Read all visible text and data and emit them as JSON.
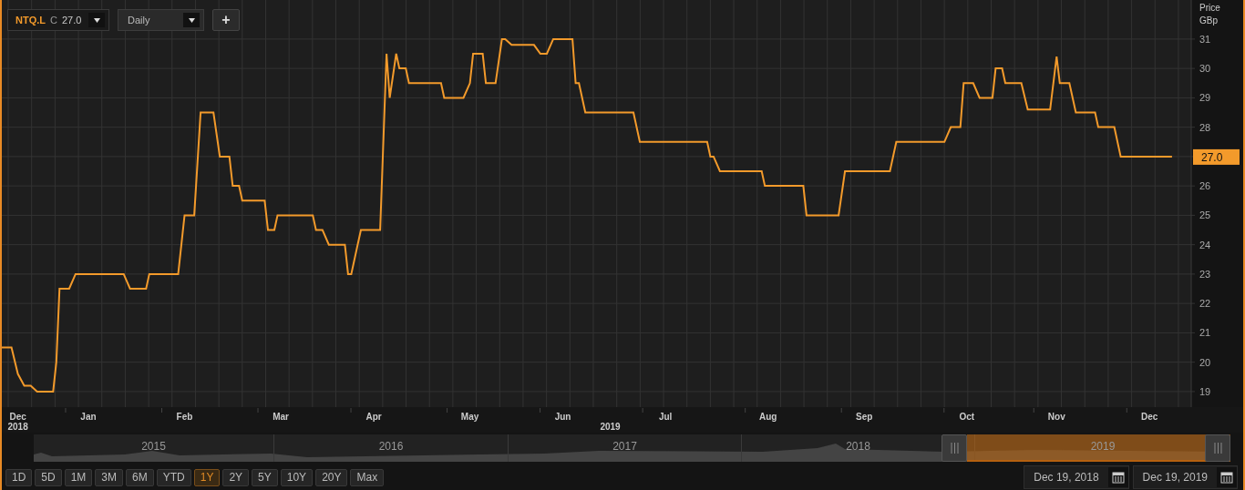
{
  "toolbar": {
    "close_label": "C",
    "close_value": "27.0",
    "interval": "Daily",
    "add_label": "+"
  },
  "chart": {
    "last_value": "27.0",
    "axis_years": [
      "2018",
      "2019"
    ],
    "ylabel_unit": "GBp",
    "chart_data": {
      "type": "line",
      "grid": true,
      "ylabel": "Price",
      "xlim": [
        "2018-12-19",
        "2019-12-25"
      ],
      "ylim": [
        18.47,
        32.33
      ],
      "yticks": [
        19,
        20,
        21,
        22,
        23,
        24,
        25,
        26,
        28,
        29,
        30,
        31
      ],
      "xticks": [
        {
          "value": "2018-12-24",
          "label": "Dec"
        },
        {
          "value": "2019-01-15",
          "label": "Jan"
        },
        {
          "value": "2019-02-14",
          "label": "Feb"
        },
        {
          "value": "2019-03-16",
          "label": "Mar"
        },
        {
          "value": "2019-04-14",
          "label": "Apr"
        },
        {
          "value": "2019-05-14",
          "label": "May"
        },
        {
          "value": "2019-06-12",
          "label": "Jun"
        },
        {
          "value": "2019-07-14",
          "label": "Jul"
        },
        {
          "value": "2019-08-15",
          "label": "Aug"
        },
        {
          "value": "2019-09-14",
          "label": "Sep"
        },
        {
          "value": "2019-10-16",
          "label": "Oct"
        },
        {
          "value": "2019-11-13",
          "label": "Nov"
        },
        {
          "value": "2019-12-12",
          "label": "Dec"
        }
      ],
      "x": [
        "2018-12-19",
        "2018-12-22",
        "2018-12-24",
        "2018-12-26",
        "2018-12-28",
        "2018-12-30",
        "2019-01-04",
        "2019-01-05",
        "2019-01-06",
        "2019-01-09",
        "2019-01-11",
        "2019-01-26",
        "2019-01-28",
        "2019-02-02",
        "2019-02-03",
        "2019-02-12",
        "2019-02-14",
        "2019-02-17",
        "2019-02-19",
        "2019-02-23",
        "2019-02-25",
        "2019-02-28",
        "2019-03-01",
        "2019-03-03",
        "2019-03-04",
        "2019-03-11",
        "2019-03-12",
        "2019-03-14",
        "2019-03-15",
        "2019-03-26",
        "2019-03-27",
        "2019-03-29",
        "2019-03-31",
        "2019-04-05",
        "2019-04-06",
        "2019-04-07",
        "2019-04-09",
        "2019-04-10",
        "2019-04-16",
        "2019-04-18",
        "2019-04-19",
        "2019-04-21",
        "2019-04-22",
        "2019-04-24",
        "2019-04-25",
        "2019-05-05",
        "2019-05-06",
        "2019-05-12",
        "2019-05-14",
        "2019-05-15",
        "2019-05-18",
        "2019-05-19",
        "2019-05-22",
        "2019-05-24",
        "2019-05-25",
        "2019-05-27",
        "2019-06-03",
        "2019-06-05",
        "2019-06-07",
        "2019-06-09",
        "2019-06-15",
        "2019-06-16",
        "2019-06-17",
        "2019-06-19",
        "2019-07-04",
        "2019-07-06",
        "2019-07-27",
        "2019-07-28",
        "2019-07-29",
        "2019-07-31",
        "2019-08-13",
        "2019-08-14",
        "2019-08-26",
        "2019-08-27",
        "2019-09-06",
        "2019-09-08",
        "2019-09-22",
        "2019-09-24",
        "2019-10-09",
        "2019-10-11",
        "2019-10-14",
        "2019-10-15",
        "2019-10-18",
        "2019-10-20",
        "2019-10-24",
        "2019-10-25",
        "2019-10-27",
        "2019-10-28",
        "2019-11-02",
        "2019-11-04",
        "2019-11-11",
        "2019-11-13",
        "2019-11-14",
        "2019-11-17",
        "2019-11-19",
        "2019-11-25",
        "2019-11-26",
        "2019-12-01",
        "2019-12-03",
        "2019-12-19"
      ],
      "series": [
        {
          "name": "NTQ.L",
          "color": "#f39a2b",
          "values": [
            20.5,
            20.5,
            19.6,
            19.2,
            19.2,
            19.0,
            19.0,
            20.0,
            22.5,
            22.5,
            23.0,
            23.0,
            22.5,
            22.5,
            23.0,
            23.0,
            25.0,
            25.0,
            28.5,
            28.5,
            27.0,
            27.0,
            26.0,
            26.0,
            25.5,
            25.5,
            24.5,
            24.5,
            25.0,
            25.0,
            24.5,
            24.5,
            24.0,
            24.0,
            23.0,
            23.0,
            24.0,
            24.5,
            24.5,
            30.5,
            29.0,
            30.5,
            30.0,
            30.0,
            29.5,
            29.5,
            29.0,
            29.0,
            29.5,
            30.5,
            30.5,
            29.5,
            29.5,
            31.0,
            31.0,
            30.8,
            30.8,
            30.5,
            30.5,
            31.0,
            31.0,
            29.5,
            29.5,
            28.5,
            28.5,
            27.5,
            27.5,
            27.0,
            27.0,
            26.5,
            26.5,
            26.0,
            26.0,
            25.0,
            25.0,
            26.5,
            26.5,
            27.5,
            27.5,
            28.0,
            28.0,
            29.5,
            29.5,
            29.0,
            29.0,
            30.0,
            30.0,
            29.5,
            29.5,
            28.6,
            28.6,
            30.4,
            29.5,
            29.5,
            28.5,
            28.5,
            28.0,
            28.0,
            27.0,
            27.0
          ]
        }
      ]
    }
  },
  "navigator": {
    "years": [
      "2015",
      "2016",
      "2017",
      "2018",
      "2019"
    ]
  },
  "ranges": [
    {
      "label": "1D",
      "selected": false
    },
    {
      "label": "5D",
      "selected": false
    },
    {
      "label": "1M",
      "selected": false
    },
    {
      "label": "3M",
      "selected": false
    },
    {
      "label": "6M",
      "selected": false
    },
    {
      "label": "YTD",
      "selected": false
    },
    {
      "label": "1Y",
      "selected": true
    },
    {
      "label": "2Y",
      "selected": false
    },
    {
      "label": "5Y",
      "selected": false
    },
    {
      "label": "10Y",
      "selected": false
    },
    {
      "label": "20Y",
      "selected": false
    },
    {
      "label": "Max",
      "selected": false
    }
  ],
  "dates": {
    "start": "Dec 19, 2018",
    "end": "Dec 19, 2019"
  }
}
